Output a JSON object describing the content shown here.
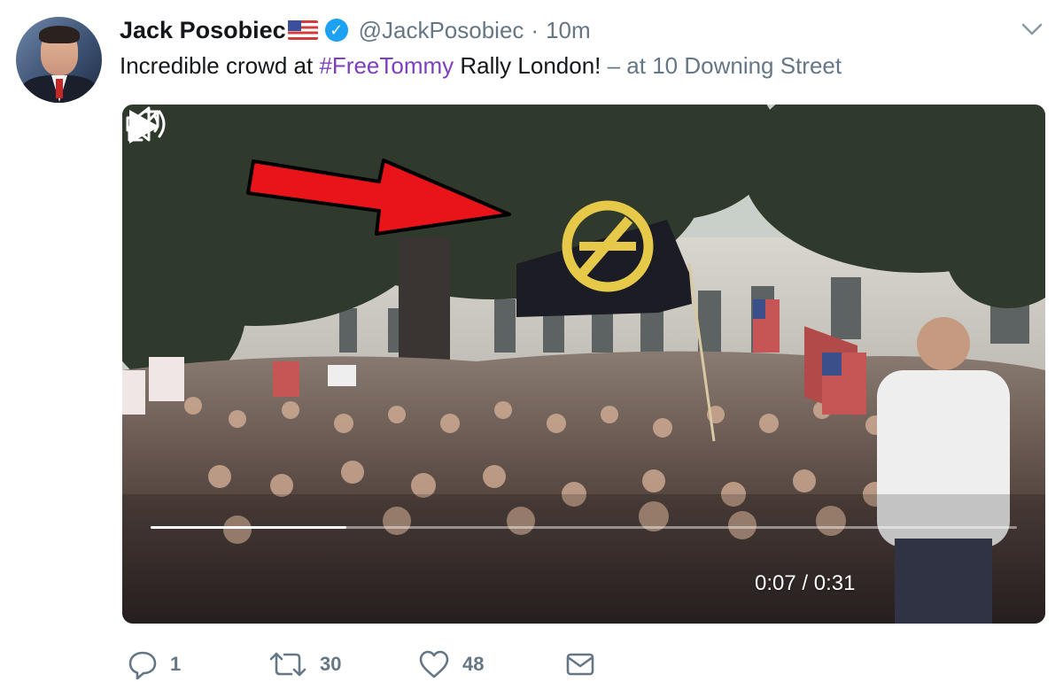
{
  "tweet": {
    "author_name": "Jack Posobiec",
    "author_flag": "us-flag-icon",
    "verified": true,
    "handle": "@JackPosobiec",
    "separator": "·",
    "time": "10m",
    "text_before": "Incredible crowd at ",
    "hashtag": "#FreeTommy",
    "text_after": " Rally London! ",
    "location": "– at 10 Downing Street",
    "colors": {
      "hashtag": "#7c3fbf",
      "muted": "#657786",
      "verified": "#1da1f2",
      "arrow": "#e8141a",
      "flag_symbol": "#e7c94a"
    }
  },
  "video": {
    "current_time": "0:07",
    "time_separator": " / ",
    "duration": "0:31",
    "progress": 0.226,
    "icons": [
      "play-icon",
      "volume-icon",
      "fullscreen-icon"
    ]
  },
  "actions": {
    "reply_count": "1",
    "retweet_count": "30",
    "like_count": "48",
    "icons": [
      "reply-icon",
      "retweet-icon",
      "like-icon",
      "message-icon"
    ]
  }
}
